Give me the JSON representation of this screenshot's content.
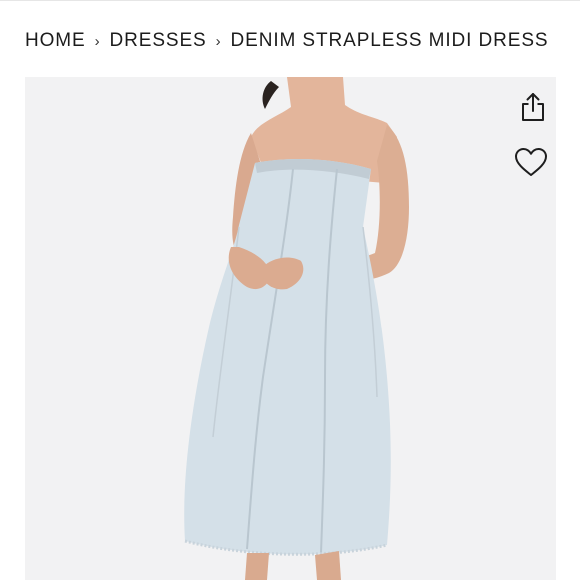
{
  "breadcrumb": {
    "items": [
      "HOME",
      "DRESSES",
      "DENIM STRAPLESS MIDI DRESS"
    ],
    "separator": "›"
  },
  "product_image": {
    "alt": "Model wearing a light-wash denim strapless midi dress",
    "background": "#f2f2f3",
    "dress_color": "#d4e0e8"
  },
  "actions": {
    "share_icon": "share-icon",
    "wishlist_icon": "heart-icon"
  }
}
